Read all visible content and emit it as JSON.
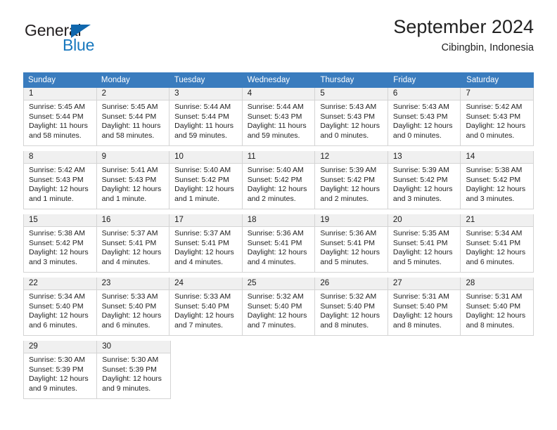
{
  "brand": {
    "name_top": "General",
    "name_bottom": "Blue",
    "accent_color": "#1878be",
    "triangle_color": "#1067ad",
    "triangle_icon": "triangle-icon"
  },
  "header": {
    "title": "September 2024",
    "subtitle": "Cibingbin, Indonesia"
  },
  "calendar": {
    "header_bg": "#3a7cbe",
    "daynum_bg": "#f0f0f0",
    "border_color": "#d4d4d4",
    "weekday_headers": [
      "Sunday",
      "Monday",
      "Tuesday",
      "Wednesday",
      "Thursday",
      "Friday",
      "Saturday"
    ],
    "weeks": [
      [
        {
          "day": "1",
          "sunrise": "Sunrise: 5:45 AM",
          "sunset": "Sunset: 5:44 PM",
          "daylight_1": "Daylight: 11 hours",
          "daylight_2": "and 58 minutes."
        },
        {
          "day": "2",
          "sunrise": "Sunrise: 5:45 AM",
          "sunset": "Sunset: 5:44 PM",
          "daylight_1": "Daylight: 11 hours",
          "daylight_2": "and 58 minutes."
        },
        {
          "day": "3",
          "sunrise": "Sunrise: 5:44 AM",
          "sunset": "Sunset: 5:44 PM",
          "daylight_1": "Daylight: 11 hours",
          "daylight_2": "and 59 minutes."
        },
        {
          "day": "4",
          "sunrise": "Sunrise: 5:44 AM",
          "sunset": "Sunset: 5:43 PM",
          "daylight_1": "Daylight: 11 hours",
          "daylight_2": "and 59 minutes."
        },
        {
          "day": "5",
          "sunrise": "Sunrise: 5:43 AM",
          "sunset": "Sunset: 5:43 PM",
          "daylight_1": "Daylight: 12 hours",
          "daylight_2": "and 0 minutes."
        },
        {
          "day": "6",
          "sunrise": "Sunrise: 5:43 AM",
          "sunset": "Sunset: 5:43 PM",
          "daylight_1": "Daylight: 12 hours",
          "daylight_2": "and 0 minutes."
        },
        {
          "day": "7",
          "sunrise": "Sunrise: 5:42 AM",
          "sunset": "Sunset: 5:43 PM",
          "daylight_1": "Daylight: 12 hours",
          "daylight_2": "and 0 minutes."
        }
      ],
      [
        {
          "day": "8",
          "sunrise": "Sunrise: 5:42 AM",
          "sunset": "Sunset: 5:43 PM",
          "daylight_1": "Daylight: 12 hours",
          "daylight_2": "and 1 minute."
        },
        {
          "day": "9",
          "sunrise": "Sunrise: 5:41 AM",
          "sunset": "Sunset: 5:43 PM",
          "daylight_1": "Daylight: 12 hours",
          "daylight_2": "and 1 minute."
        },
        {
          "day": "10",
          "sunrise": "Sunrise: 5:40 AM",
          "sunset": "Sunset: 5:42 PM",
          "daylight_1": "Daylight: 12 hours",
          "daylight_2": "and 1 minute."
        },
        {
          "day": "11",
          "sunrise": "Sunrise: 5:40 AM",
          "sunset": "Sunset: 5:42 PM",
          "daylight_1": "Daylight: 12 hours",
          "daylight_2": "and 2 minutes."
        },
        {
          "day": "12",
          "sunrise": "Sunrise: 5:39 AM",
          "sunset": "Sunset: 5:42 PM",
          "daylight_1": "Daylight: 12 hours",
          "daylight_2": "and 2 minutes."
        },
        {
          "day": "13",
          "sunrise": "Sunrise: 5:39 AM",
          "sunset": "Sunset: 5:42 PM",
          "daylight_1": "Daylight: 12 hours",
          "daylight_2": "and 3 minutes."
        },
        {
          "day": "14",
          "sunrise": "Sunrise: 5:38 AM",
          "sunset": "Sunset: 5:42 PM",
          "daylight_1": "Daylight: 12 hours",
          "daylight_2": "and 3 minutes."
        }
      ],
      [
        {
          "day": "15",
          "sunrise": "Sunrise: 5:38 AM",
          "sunset": "Sunset: 5:42 PM",
          "daylight_1": "Daylight: 12 hours",
          "daylight_2": "and 3 minutes."
        },
        {
          "day": "16",
          "sunrise": "Sunrise: 5:37 AM",
          "sunset": "Sunset: 5:41 PM",
          "daylight_1": "Daylight: 12 hours",
          "daylight_2": "and 4 minutes."
        },
        {
          "day": "17",
          "sunrise": "Sunrise: 5:37 AM",
          "sunset": "Sunset: 5:41 PM",
          "daylight_1": "Daylight: 12 hours",
          "daylight_2": "and 4 minutes."
        },
        {
          "day": "18",
          "sunrise": "Sunrise: 5:36 AM",
          "sunset": "Sunset: 5:41 PM",
          "daylight_1": "Daylight: 12 hours",
          "daylight_2": "and 4 minutes."
        },
        {
          "day": "19",
          "sunrise": "Sunrise: 5:36 AM",
          "sunset": "Sunset: 5:41 PM",
          "daylight_1": "Daylight: 12 hours",
          "daylight_2": "and 5 minutes."
        },
        {
          "day": "20",
          "sunrise": "Sunrise: 5:35 AM",
          "sunset": "Sunset: 5:41 PM",
          "daylight_1": "Daylight: 12 hours",
          "daylight_2": "and 5 minutes."
        },
        {
          "day": "21",
          "sunrise": "Sunrise: 5:34 AM",
          "sunset": "Sunset: 5:41 PM",
          "daylight_1": "Daylight: 12 hours",
          "daylight_2": "and 6 minutes."
        }
      ],
      [
        {
          "day": "22",
          "sunrise": "Sunrise: 5:34 AM",
          "sunset": "Sunset: 5:40 PM",
          "daylight_1": "Daylight: 12 hours",
          "daylight_2": "and 6 minutes."
        },
        {
          "day": "23",
          "sunrise": "Sunrise: 5:33 AM",
          "sunset": "Sunset: 5:40 PM",
          "daylight_1": "Daylight: 12 hours",
          "daylight_2": "and 6 minutes."
        },
        {
          "day": "24",
          "sunrise": "Sunrise: 5:33 AM",
          "sunset": "Sunset: 5:40 PM",
          "daylight_1": "Daylight: 12 hours",
          "daylight_2": "and 7 minutes."
        },
        {
          "day": "25",
          "sunrise": "Sunrise: 5:32 AM",
          "sunset": "Sunset: 5:40 PM",
          "daylight_1": "Daylight: 12 hours",
          "daylight_2": "and 7 minutes."
        },
        {
          "day": "26",
          "sunrise": "Sunrise: 5:32 AM",
          "sunset": "Sunset: 5:40 PM",
          "daylight_1": "Daylight: 12 hours",
          "daylight_2": "and 8 minutes."
        },
        {
          "day": "27",
          "sunrise": "Sunrise: 5:31 AM",
          "sunset": "Sunset: 5:40 PM",
          "daylight_1": "Daylight: 12 hours",
          "daylight_2": "and 8 minutes."
        },
        {
          "day": "28",
          "sunrise": "Sunrise: 5:31 AM",
          "sunset": "Sunset: 5:40 PM",
          "daylight_1": "Daylight: 12 hours",
          "daylight_2": "and 8 minutes."
        }
      ],
      [
        {
          "day": "29",
          "sunrise": "Sunrise: 5:30 AM",
          "sunset": "Sunset: 5:39 PM",
          "daylight_1": "Daylight: 12 hours",
          "daylight_2": "and 9 minutes."
        },
        {
          "day": "30",
          "sunrise": "Sunrise: 5:30 AM",
          "sunset": "Sunset: 5:39 PM",
          "daylight_1": "Daylight: 12 hours",
          "daylight_2": "and 9 minutes."
        },
        {
          "day": "",
          "sunrise": "",
          "sunset": "",
          "daylight_1": "",
          "daylight_2": ""
        },
        {
          "day": "",
          "sunrise": "",
          "sunset": "",
          "daylight_1": "",
          "daylight_2": ""
        },
        {
          "day": "",
          "sunrise": "",
          "sunset": "",
          "daylight_1": "",
          "daylight_2": ""
        },
        {
          "day": "",
          "sunrise": "",
          "sunset": "",
          "daylight_1": "",
          "daylight_2": ""
        },
        {
          "day": "",
          "sunrise": "",
          "sunset": "",
          "daylight_1": "",
          "daylight_2": ""
        }
      ]
    ]
  }
}
